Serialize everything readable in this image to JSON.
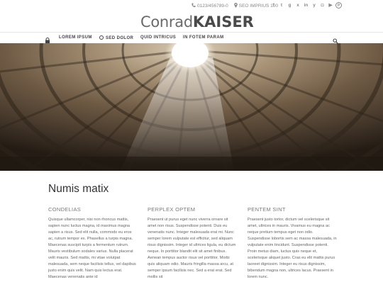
{
  "topbar": {
    "phone": "0123/456789-0",
    "location": "SEO IMPRIUS 100",
    "social": [
      {
        "icon": "facebook-icon",
        "glyph": "f"
      },
      {
        "icon": "twitter-icon",
        "glyph": "t"
      },
      {
        "icon": "google-plus-icon",
        "glyph": "g"
      },
      {
        "icon": "xing-icon",
        "glyph": "x"
      },
      {
        "icon": "linkedin-icon",
        "glyph": "in"
      },
      {
        "icon": "yelp-icon",
        "glyph": "y"
      },
      {
        "icon": "instagram-icon",
        "glyph": "◘"
      },
      {
        "icon": "youtube-icon",
        "glyph": "▶"
      },
      {
        "icon": "pinterest-icon",
        "glyph": "p"
      }
    ]
  },
  "logo": {
    "light": "Conrad",
    "bold": "KAISER"
  },
  "nav": {
    "items": [
      "LOREM IPSUM",
      "SED DOLOR",
      "QUID INTRICUS",
      "IN FOTEM PARAM"
    ]
  },
  "main": {
    "title": "Numis matix",
    "columns": [
      {
        "heading": "CONDELIAS",
        "text": "Quisque ullamcorper, nisi non rhoncus mattis, sapien nunc luctus magna, id maximus magna sapien a risus. Sed elit nulla, commodo eu eros ac, rutrum tempor ex. Phasellus a turpis magna. Maecenas suscipit turpis a fermentum rutrum. Mauris vestibulum sodales varius. Nulla placerat velit mauris. Sed mattis, mi vitae volutpat malesuada, sem neque facilisis tellus, vel dapibus justo enim quis velit. Nam quis lectus erat. Maecenas venenatis ante id"
      },
      {
        "heading": "PERPLEX OPTEM",
        "text": "Praesent ut purus eget nunc viverra ornare sit amet non risus. Suspendisse potenti. Duis eu venenatis nunc. Integer malesuada erat mi. Nunc semper lorem vulputate est efficitur, sed aliquam risus dignissim. Integer id ultrices ligula, eu dictum neque. In porttitor blandit elit sit amet finibus. Aenean tempus auctor risus vel porttitor. Morbi quis aliquam odio. Mauris fringilla massa arcu, at semper ipsum facilisis nec. Sed a erat erat. Sed mollis sit"
      },
      {
        "heading": "PENTEM SINT",
        "text": "Praesent justo tortor, dictum vel scelerisque sit amet, ultrices in mauris. Vivamus eu magna ac neque pretium tempus eget non odio. Suspendisse lobortis sem ac massa malesuada, in vulputate enim tincidunt. Suspendisse potenti. Proin metus diam, luctus quis neque et, scelerisque aliquet justo. Cras eu elit mattis purus laoreet dignissim. Integer eu risus dignissim, bibendum magna non, ultrices lacus. Praesent in lorem nunc."
      }
    ]
  }
}
